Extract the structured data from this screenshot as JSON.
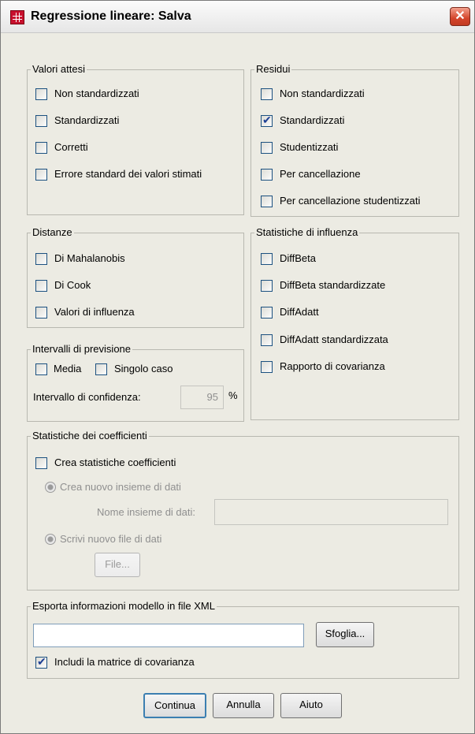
{
  "window": {
    "title": "Regressione lineare: Salva"
  },
  "predicted": {
    "legend": "Valori attesi",
    "items": [
      {
        "label": "Non standardizzati",
        "checked": false
      },
      {
        "label": "Standardizzati",
        "checked": false
      },
      {
        "label": "Corretti",
        "checked": false
      },
      {
        "label": "Errore standard dei valori stimati",
        "checked": false
      }
    ]
  },
  "residuals": {
    "legend": "Residui",
    "items": [
      {
        "label": "Non standardizzati",
        "checked": false
      },
      {
        "label": "Standardizzati",
        "checked": true
      },
      {
        "label": "Studentizzati",
        "checked": false
      },
      {
        "label": "Per cancellazione",
        "checked": false
      },
      {
        "label": "Per cancellazione studentizzati",
        "checked": false
      }
    ]
  },
  "distances": {
    "legend": "Distanze",
    "items": [
      {
        "label": "Di Mahalanobis",
        "checked": false
      },
      {
        "label": "Di Cook",
        "checked": false
      },
      {
        "label": "Valori di influenza",
        "checked": false
      }
    ]
  },
  "influence": {
    "legend": "Statistiche di influenza",
    "items": [
      {
        "label": "DiffBeta",
        "checked": false
      },
      {
        "label": "DiffBeta standardizzate",
        "checked": false
      },
      {
        "label": "DiffAdatt",
        "checked": false
      },
      {
        "label": "DiffAdatt standardizzata",
        "checked": false
      },
      {
        "label": "Rapporto di covarianza",
        "checked": false
      }
    ]
  },
  "prediction_intervals": {
    "legend": "Intervalli di previsione",
    "mean_label": "Media",
    "individual_label": "Singolo caso",
    "confidence_label": "Intervallo di confidenza:",
    "confidence_value": "95",
    "percent": "%"
  },
  "coef_stats": {
    "legend": "Statistiche dei coefficienti",
    "create_label": "Crea statistiche coefficienti",
    "new_dataset_label": "Crea nuovo insieme di dati",
    "dataset_name_label": "Nome insieme di dati:",
    "dataset_name_value": "",
    "new_file_label": "Scrivi nuovo file di dati",
    "file_button": "File..."
  },
  "export": {
    "legend": "Esporta informazioni modello in file XML",
    "path_value": "",
    "browse_button": "Sfoglia...",
    "covariance_label": "Includi la matrice di covarianza",
    "covariance_checked": true
  },
  "buttons": {
    "continue": "Continua",
    "cancel": "Annulla",
    "help": "Aiuto"
  }
}
